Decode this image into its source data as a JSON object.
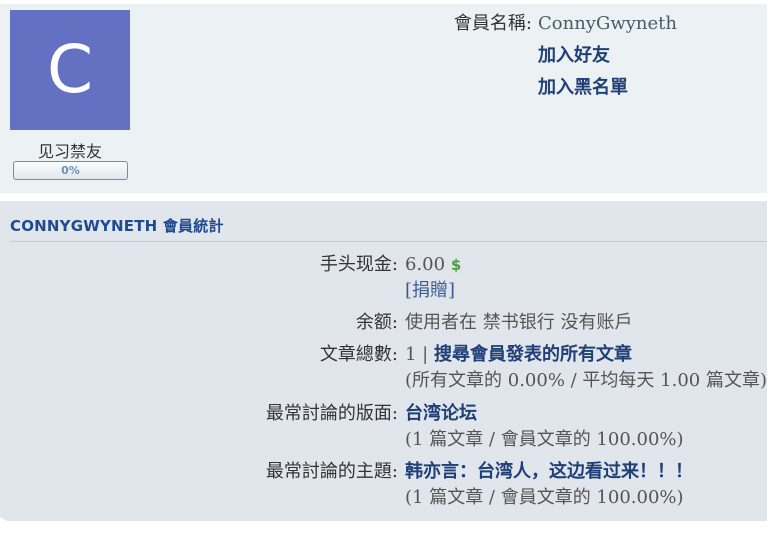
{
  "profile": {
    "avatar_letter": "C",
    "avatar_color": "#6470c2",
    "rank_title": "见习禁友",
    "rank_progress_text": "0%",
    "rank_progress": 0,
    "username_label": "會員名稱:",
    "username": "ConnyGwyneth",
    "add_friend": "加入好友",
    "add_blacklist": "加入黑名單"
  },
  "stats": {
    "heading": "CONNYGWYNETH 會員統計",
    "cash_label": "手头现金:",
    "cash_value": "6.00",
    "cash_icon": "$",
    "donate": "[捐贈]",
    "balance_label": "余额:",
    "balance_value": "使用者在 禁书银行 没有账戶",
    "posts_label": "文章總數:",
    "posts_count": "1 |",
    "posts_search": "搜尋會員發表的所有文章",
    "posts_sub": "(所有文章的 0.00% / 平均每天 1.00 篇文章)",
    "active_forum_label": "最常討論的版面:",
    "active_forum": "台湾论坛",
    "active_forum_sub": "(1 篇文章 / 會員文章的 100.00%)",
    "active_topic_label": "最常討論的主題:",
    "active_topic": "韩亦言：台湾人，这边看过来！！！",
    "active_topic_sub": "(1 篇文章 / 會員文章的 100.00%)"
  },
  "colors": {
    "link": "#1f3f76",
    "heading": "#1f4a8e",
    "panel_top": "#ecf1f3",
    "panel_stats": "#e1e6ec",
    "dollar": "#4aa03a"
  }
}
